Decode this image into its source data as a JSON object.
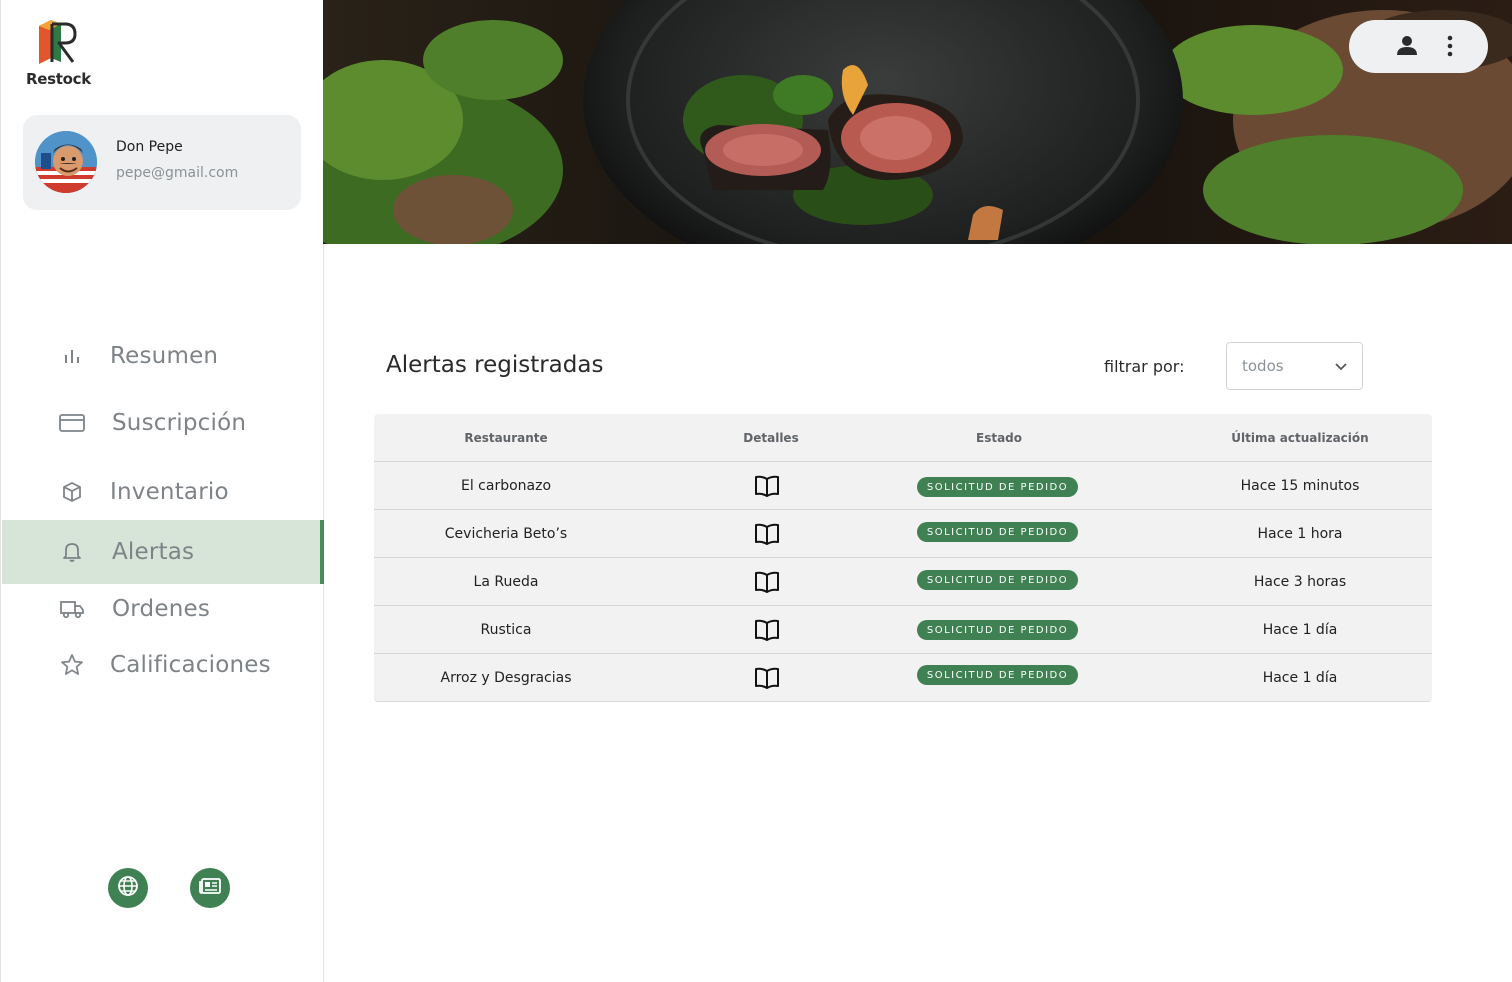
{
  "brand": {
    "name": "Restock"
  },
  "user": {
    "name": "Don Pepe",
    "email": "pepe@gmail.com"
  },
  "nav": {
    "items": [
      {
        "label": "Resumen",
        "icon": "bar-chart-icon"
      },
      {
        "label": "Suscripción",
        "icon": "credit-card-icon"
      },
      {
        "label": "Inventario",
        "icon": "box-icon"
      },
      {
        "label": "Alertas",
        "icon": "bell-icon",
        "active": true
      },
      {
        "label": "Ordenes",
        "icon": "truck-icon"
      },
      {
        "label": "Calificaciones",
        "icon": "star-icon"
      }
    ]
  },
  "footer": {
    "buttons": [
      "globe-icon",
      "newspaper-icon"
    ]
  },
  "topbar": {
    "icons": [
      "user-icon",
      "more-vertical-icon"
    ]
  },
  "main": {
    "title": "Alertas registradas",
    "filter_label": "filtrar por:",
    "filter_value": "todos"
  },
  "table": {
    "headers": [
      "Restaurante",
      "Detalles",
      "Estado",
      "Última actualización"
    ],
    "rows": [
      {
        "restaurant": "El carbonazo",
        "status": "SOLICITUD DE PEDIDO",
        "updated": "Hace 15 minutos"
      },
      {
        "restaurant": "Cevicheria Beto’s",
        "status": "SOLICITUD DE PEDIDO",
        "updated": "Hace 1 hora"
      },
      {
        "restaurant": "La Rueda",
        "status": "SOLICITUD DE PEDIDO",
        "updated": "Hace 3 horas"
      },
      {
        "restaurant": "Rustica",
        "status": "SOLICITUD DE PEDIDO",
        "updated": "Hace 1 día"
      },
      {
        "restaurant": "Arroz y Desgracias",
        "status": "SOLICITUD DE PEDIDO",
        "updated": "Hace 1 día"
      }
    ]
  },
  "colors": {
    "accent": "#3f8152",
    "active_bg": "#d7e4d8",
    "nav_text": "#7d8387"
  }
}
